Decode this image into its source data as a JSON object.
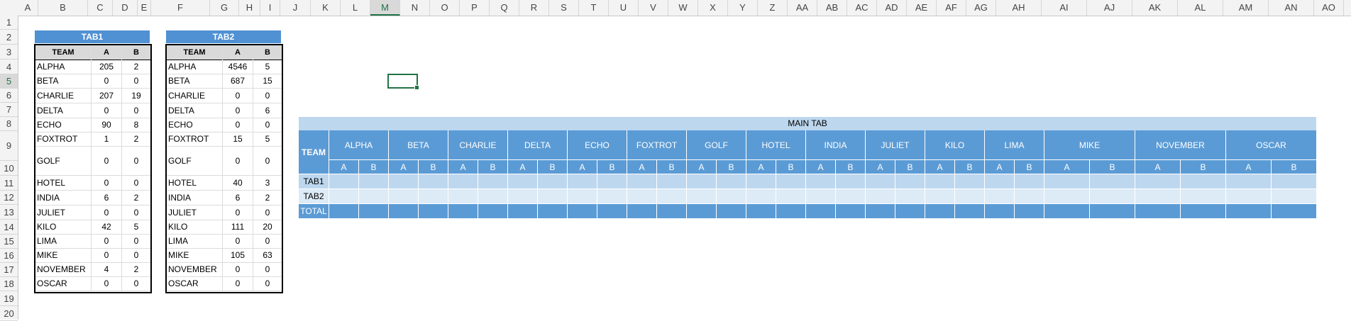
{
  "columns": [
    "A",
    "B",
    "C",
    "D",
    "E",
    "F",
    "G",
    "H",
    "I",
    "J",
    "K",
    "L",
    "M",
    "N",
    "O",
    "P",
    "Q",
    "R",
    "S",
    "T",
    "U",
    "V",
    "W",
    "X",
    "Y",
    "Z",
    "AA",
    "AB",
    "AC",
    "AD",
    "AE",
    "AF",
    "AG",
    "AH",
    "AI",
    "AJ",
    "AK",
    "AL",
    "AM",
    "AN",
    "AO"
  ],
  "rows": [
    "1",
    "2",
    "3",
    "4",
    "5",
    "6",
    "7",
    "8",
    "9",
    "10",
    "11",
    "12",
    "13",
    "14",
    "15",
    "16",
    "17",
    "18",
    "19",
    "20"
  ],
  "selected_column": "M",
  "selected_row": "5",
  "tab1": {
    "title": "TAB1",
    "headers": [
      "TEAM",
      "A",
      "B"
    ],
    "rows": [
      [
        "ALPHA",
        "205",
        "2"
      ],
      [
        "BETA",
        "0",
        "0"
      ],
      [
        "CHARLIE",
        "207",
        "19"
      ],
      [
        "DELTA",
        "0",
        "0"
      ],
      [
        "ECHO",
        "90",
        "8"
      ],
      [
        "FOXTROT",
        "1",
        "2"
      ],
      [
        "GOLF",
        "0",
        "0"
      ],
      [
        "HOTEL",
        "0",
        "0"
      ],
      [
        "INDIA",
        "6",
        "2"
      ],
      [
        "JULIET",
        "0",
        "0"
      ],
      [
        "KILO",
        "42",
        "5"
      ],
      [
        "LIMA",
        "0",
        "0"
      ],
      [
        "MIKE",
        "0",
        "0"
      ],
      [
        "NOVEMBER",
        "4",
        "2"
      ],
      [
        "OSCAR",
        "0",
        "0"
      ]
    ]
  },
  "tab2": {
    "title": "TAB2",
    "headers": [
      "TEAM",
      "A",
      "B"
    ],
    "rows": [
      [
        "ALPHA",
        "4546",
        "5"
      ],
      [
        "BETA",
        "687",
        "15"
      ],
      [
        "CHARLIE",
        "0",
        "0"
      ],
      [
        "DELTA",
        "0",
        "6"
      ],
      [
        "ECHO",
        "0",
        "0"
      ],
      [
        "FOXTROT",
        "15",
        "5"
      ],
      [
        "GOLF",
        "0",
        "0"
      ],
      [
        "HOTEL",
        "40",
        "3"
      ],
      [
        "INDIA",
        "6",
        "2"
      ],
      [
        "JULIET",
        "0",
        "0"
      ],
      [
        "KILO",
        "111",
        "20"
      ],
      [
        "LIMA",
        "0",
        "0"
      ],
      [
        "MIKE",
        "105",
        "63"
      ],
      [
        "NOVEMBER",
        "0",
        "0"
      ],
      [
        "OSCAR",
        "0",
        "0"
      ]
    ]
  },
  "main": {
    "title": "MAIN TAB",
    "team_label": "TEAM",
    "teams": [
      "ALPHA",
      "BETA",
      "CHARLIE",
      "DELTA",
      "ECHO",
      "FOXTROT",
      "GOLF",
      "HOTEL",
      "INDIA",
      "JULIET",
      "KILO",
      "LIMA",
      "MIKE",
      "NOVEMBER",
      "OSCAR"
    ],
    "sub_a": "A",
    "sub_b": "B",
    "row_labels": [
      "TAB1",
      "TAB2",
      "TOTAL"
    ]
  },
  "colors": {
    "header_blue": "#5b9bd5",
    "light_blue": "#bdd7ee",
    "lighter_blue": "#ddebf7",
    "excel_green": "#217346"
  }
}
